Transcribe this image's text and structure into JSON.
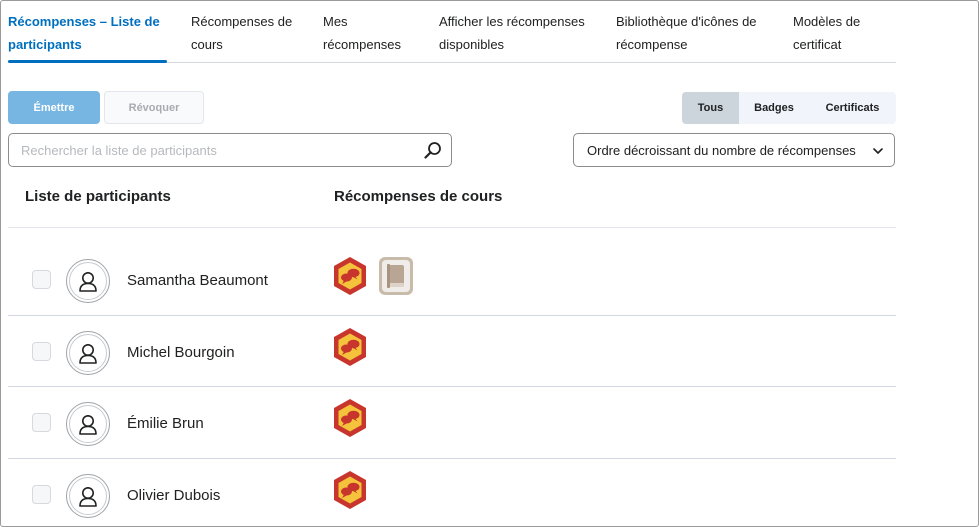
{
  "tabs": [
    {
      "label": "Récompenses – Liste de participants",
      "active": true
    },
    {
      "label": "Récompenses de cours",
      "active": false
    },
    {
      "label": "Mes récompenses",
      "active": false
    },
    {
      "label": "Afficher les récompenses disponibles",
      "active": false
    },
    {
      "label": "Bibliothèque d'icônes de récompense",
      "active": false
    },
    {
      "label": "Modèles de certificat",
      "active": false
    }
  ],
  "toolbar": {
    "issue_label": "Émettre",
    "revoke_label": "Révoquer",
    "filters": [
      "Tous",
      "Badges",
      "Certificats"
    ],
    "selected_filter": "Tous"
  },
  "search": {
    "placeholder": "Rechercher la liste de participants",
    "value": "",
    "icon": "search-icon"
  },
  "sort": {
    "selected": "Ordre décroissant du nombre de récompenses",
    "icon": "chevron-down-icon"
  },
  "columns": {
    "participants": "Liste de participants",
    "awards": "Récompenses de cours"
  },
  "participants": [
    {
      "name": "Samantha Beaumont",
      "badges": [
        "speech-bubble-badge-icon",
        "book-badge-icon"
      ]
    },
    {
      "name": "Michel Bourgoin",
      "badges": [
        "speech-bubble-badge-icon"
      ]
    },
    {
      "name": "Émilie Brun",
      "badges": [
        "speech-bubble-badge-icon"
      ]
    },
    {
      "name": "Olivier Dubois",
      "badges": [
        "speech-bubble-badge-icon"
      ]
    }
  ],
  "colors": {
    "accent": "#006fbf",
    "issue_button": "#77b6e2",
    "badge_red": "#c8352d",
    "badge_yellow": "#f5c33b",
    "book_badge": "#c4b5a5"
  }
}
